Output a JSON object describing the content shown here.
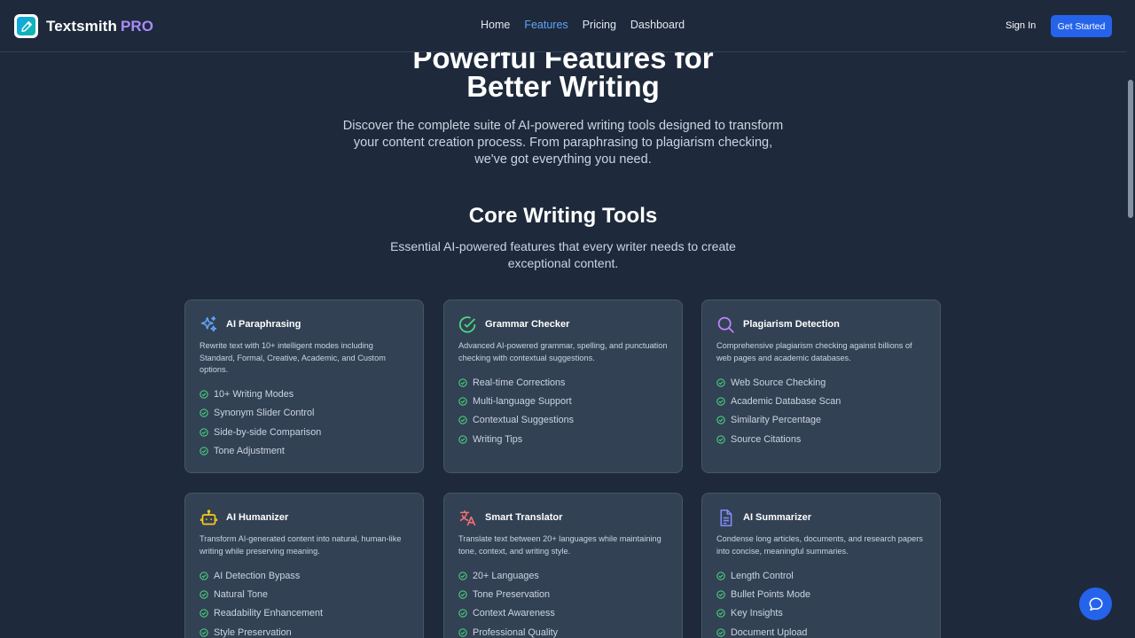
{
  "nav": {
    "brand": "Textsmith",
    "brand_badge": "PRO",
    "links": [
      "Home",
      "Features",
      "Pricing",
      "Dashboard"
    ],
    "active_link": "Features",
    "sign_in": "Sign In",
    "cta": "Get Started"
  },
  "hero": {
    "title_line1": "Powerful Features for",
    "title_line2": "Better Writing",
    "subtitle": "Discover the complete suite of AI-powered writing tools designed to transform your content creation process. From paraphrasing to plagiarism checking, we've got everything you need."
  },
  "section": {
    "title": "Core Writing Tools",
    "subtitle": "Essential AI-powered features that every writer needs to create exceptional content."
  },
  "cards": [
    {
      "icon": "sparkles-icon",
      "icon_color": "#60a5fa",
      "title": "AI Paraphrasing",
      "desc": "Rewrite text with 10+ intelligent modes including Standard, Formal, Creative, Academic, and Custom options.",
      "features": [
        "10+ Writing Modes",
        "Synonym Slider Control",
        "Side-by-side Comparison",
        "Tone Adjustment"
      ]
    },
    {
      "icon": "check-circle-icon",
      "icon_color": "#4ade80",
      "title": "Grammar Checker",
      "desc": "Advanced AI-powered grammar, spelling, and punctuation checking with contextual suggestions.",
      "features": [
        "Real-time Corrections",
        "Multi-language Support",
        "Contextual Suggestions",
        "Writing Tips"
      ]
    },
    {
      "icon": "magnifier-icon",
      "icon_color": "#c084fc",
      "title": "Plagiarism Detection",
      "desc": "Comprehensive plagiarism checking against billions of web pages and academic databases.",
      "features": [
        "Web Source Checking",
        "Academic Database Scan",
        "Similarity Percentage",
        "Source Citations"
      ]
    },
    {
      "icon": "robot-icon",
      "icon_color": "#facc15",
      "title": "AI Humanizer",
      "desc": "Transform AI-generated content into natural, human-like writing while preserving meaning.",
      "features": [
        "AI Detection Bypass",
        "Natural Tone",
        "Readability Enhancement",
        "Style Preservation"
      ]
    },
    {
      "icon": "translate-icon",
      "icon_color": "#f87171",
      "title": "Smart Translator",
      "desc": "Translate text between 20+ languages while maintaining tone, context, and writing style.",
      "features": [
        "20+ Languages",
        "Tone Preservation",
        "Context Awareness",
        "Professional Quality"
      ]
    },
    {
      "icon": "document-icon",
      "icon_color": "#818cf8",
      "title": "AI Summarizer",
      "desc": "Condense long articles, documents, and research papers into concise, meaningful summaries.",
      "features": [
        "Length Control",
        "Bullet Points Mode",
        "Key Insights",
        "Document Upload"
      ]
    }
  ],
  "colors": {
    "background": "#1e293b",
    "card": "#334155",
    "accent": "#2563eb",
    "check": "#4ade80"
  }
}
